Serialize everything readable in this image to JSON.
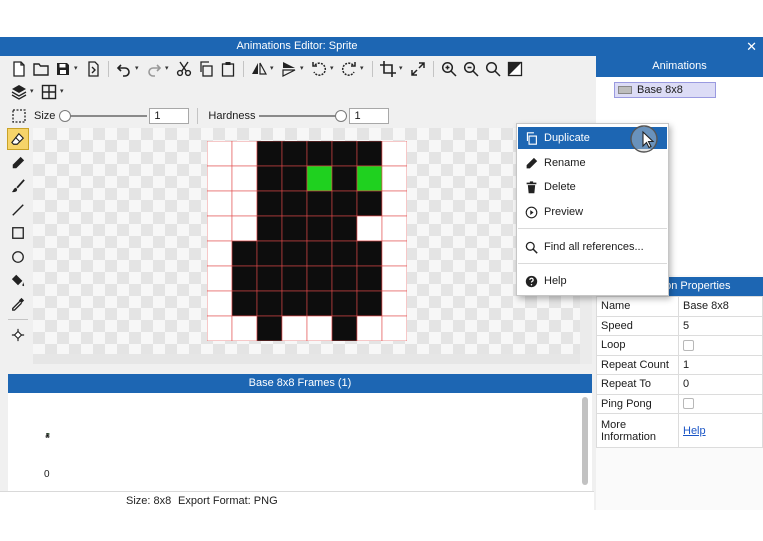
{
  "window": {
    "title": "Animations Editor: Sprite",
    "close_icon": "close-icon"
  },
  "toolbar": {
    "row1_icons": [
      "new-file-icon",
      "open-folder-icon",
      "save-icon",
      "export-icon",
      "undo-icon",
      "redo-icon",
      "cut-icon",
      "copy-icon",
      "paste-icon",
      "flip-horizontal-icon",
      "flip-vertical-icon",
      "rotate-left-icon",
      "rotate-right-icon",
      "crop-icon",
      "resize-icon",
      "zoom-in-icon",
      "zoom-out-icon",
      "zoom-fit-icon",
      "invert-icon"
    ],
    "row2_icons": [
      "layers-icon",
      "grid-icon"
    ]
  },
  "brush": {
    "size_label": "Size",
    "size_value": "1",
    "size_level_fraction": 0.0,
    "hardness_label": "Hardness",
    "hardness_value": "1",
    "hardness_level_fraction": 1.0
  },
  "tools": [
    "eraser-icon",
    "pencil-icon",
    "brush-icon",
    "line-icon",
    "rectangle-icon",
    "ellipse-icon",
    "fill-bucket-icon",
    "eyedropper-icon",
    "origin-icon"
  ],
  "sprite": {
    "columns": 8,
    "rows": 8,
    "colors": {
      "B": "#0d0d0d",
      "G": "#1fd11f",
      "W": "#ffffff"
    },
    "pixels": [
      "..BBBBB.",
      "..BBGBG.",
      "..BBBBB.",
      "..BBBB..",
      ".BBBBBB.",
      ".BBBBBB.",
      ".BBBBBB.",
      "..B..B.."
    ]
  },
  "frames": {
    "header": "Base 8x8 Frames (1)",
    "index_label": "0"
  },
  "status": {
    "size": "Size: 8x8",
    "export_format": "Export Format: PNG"
  },
  "animations": {
    "header": "Animations",
    "items": [
      {
        "label": "Base 8x8"
      }
    ]
  },
  "context_menu": {
    "items": [
      {
        "label": "Duplicate",
        "icon": "duplicate-icon",
        "highlighted": true
      },
      {
        "label": "Rename",
        "icon": "pencil-icon"
      },
      {
        "label": "Delete",
        "icon": "trash-icon"
      },
      {
        "label": "Preview",
        "icon": "play-circle-icon"
      },
      {
        "label": "Find all references...",
        "icon": "search-icon"
      },
      {
        "label": "Help",
        "icon": "help-icon"
      }
    ]
  },
  "properties": {
    "header": "Animation Properties",
    "rows": [
      {
        "key": "Name",
        "value": "Base 8x8"
      },
      {
        "key": "Speed",
        "value": "5"
      },
      {
        "key": "Loop",
        "checked": false
      },
      {
        "key": "Repeat Count",
        "value": "1"
      },
      {
        "key": "Repeat To",
        "value": "0"
      },
      {
        "key": "Ping Pong",
        "checked": false
      },
      {
        "key": "More Information",
        "link": "Help"
      }
    ]
  },
  "colors": {
    "accent": "#1d66b3",
    "menu_highlight": "#1d66b3",
    "active_tool": "#f6d46a"
  }
}
